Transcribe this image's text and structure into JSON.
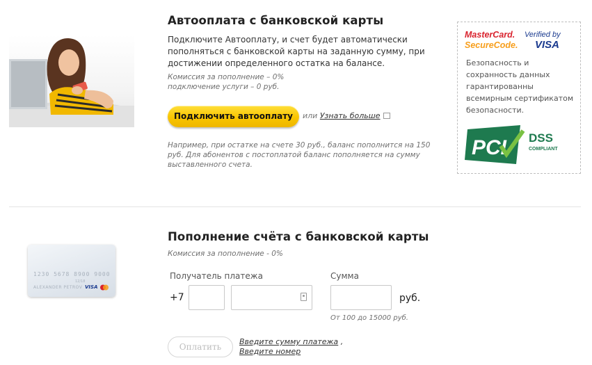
{
  "autopay": {
    "title": "Автооплата с банковской карты",
    "description": "Подключите Автооплату, и счет будет автоматически пополняться с банковской карты на заданную сумму, при достижении определенного остатка на балансе.",
    "fee_line": "Комиссия за пополнение – 0%",
    "connect_line": "подключение услуги – 0 руб.",
    "connect_button": "Подключить автооплату",
    "or_text": "или",
    "learn_more": "Узнать больше",
    "example": "Например, при остатке на счете 30 руб., баланс пополнится на 150 руб. Для абонентов с постоплатой баланс пополняется на сумму выставленного счета."
  },
  "security": {
    "mastercard_line1": "MasterCard.",
    "mastercard_line2": "SecureCode.",
    "visa_line1": "Verified by",
    "visa_line2": "VISA",
    "text": "Безопасность и сохранность данных гарантированны всемирным сертификатом безопасности.",
    "pci_logo": "PCI",
    "dss_line1": "DSS",
    "dss_line2": "COMPLIANT"
  },
  "topup": {
    "title": "Пополнение счёта с банковской карты",
    "fee_line": "Комиссия за пополнение - 0%",
    "recipient_label": "Получатель платежа",
    "country_code": "+7",
    "code_value": "",
    "phone_value": "",
    "amount_label": "Сумма",
    "amount_value": "",
    "currency": "руб.",
    "range_hint": "От 100 до 15000 руб.",
    "pay_button": "Оплатить",
    "hint_amount": "Введите сумму платежа",
    "hint_sep": ",",
    "hint_number": "Введите номер"
  },
  "card_image": {
    "number": "1230 5678 8900 9000",
    "expiry": "12/18",
    "holder": "ALEXANDER PETROV",
    "brand": "VISA"
  },
  "colors": {
    "accent_yellow": "#f9c500",
    "pci_green": "#1e7a4f",
    "visa_blue": "#1a3a8f",
    "mastercard_red": "#d9232e",
    "mastercard_orange": "#f79e1b"
  }
}
